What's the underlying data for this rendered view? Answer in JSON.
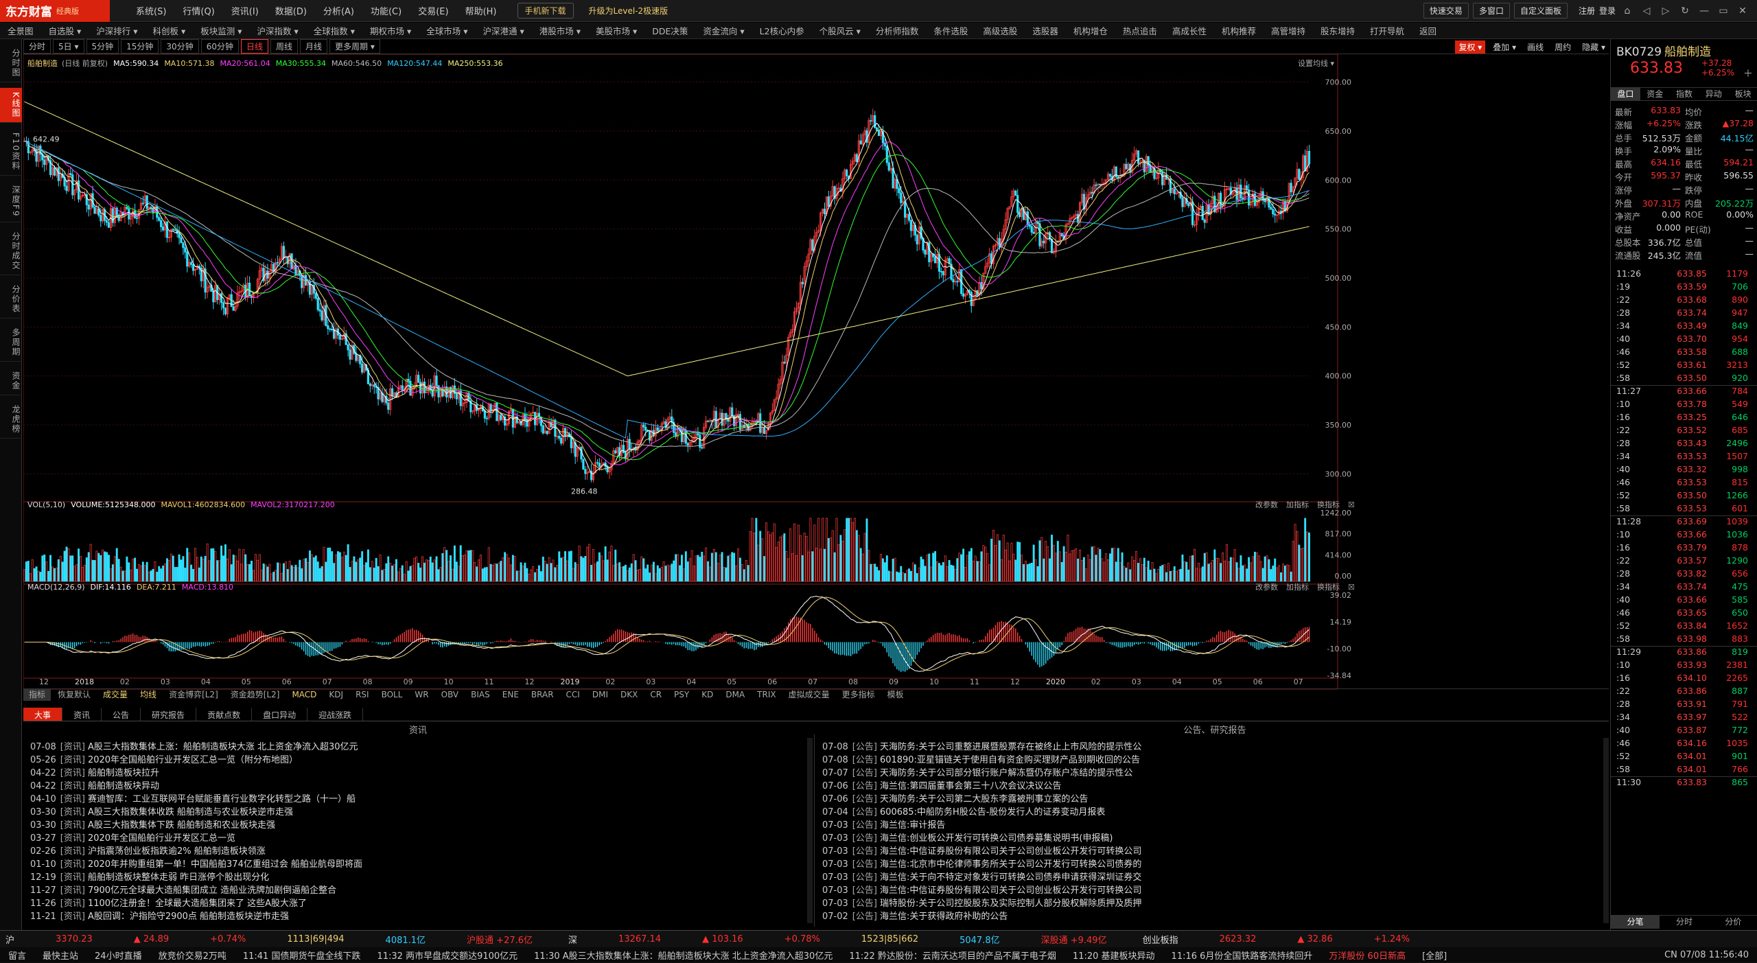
{
  "app": {
    "logo": "东方财富",
    "edition": "经典版",
    "menu": [
      "系统(S)",
      "行情(Q)",
      "资讯(I)",
      "数据(D)",
      "分析(A)",
      "功能(C)",
      "交易(E)",
      "帮助(H)"
    ],
    "mobile_btn": "手机新下载",
    "upgrade": "升级为Level-2极速版",
    "right_btns": [
      "快速交易",
      "多窗口",
      "自定义面板"
    ],
    "login": "注册",
    "login2": "登录"
  },
  "nav": [
    "全景图",
    "自选股 ▾",
    "沪深排行 ▾",
    "科创板 ▾",
    "板块监测 ▾",
    "沪深指数 ▾",
    "全球指数 ▾",
    "期权市场 ▾",
    "全球市场 ▾",
    "沪深港通 ▾",
    "港股市场 ▾",
    "美股市场 ▾",
    "DDE决策",
    "资金流向 ▾",
    "L2核心内参",
    "个股风云 ▾",
    "分析师指数",
    "条件选股",
    "高级选股",
    "选股器",
    "机构增仓",
    "热点追击",
    "高成长性",
    "机构推荐",
    "高管增持",
    "股东增持",
    "打开导航",
    "返回"
  ],
  "sidebar": [
    "分时图",
    "K线图",
    "F10资料",
    "深度F9",
    "分时成交",
    "分价表",
    "多周期",
    "资金",
    "龙虎榜"
  ],
  "kbar": [
    "分时",
    "5日 ▾",
    "5分钟",
    "15分钟",
    "30分钟",
    "60分钟",
    "日线",
    "周线",
    "月线",
    "更多周期 ▾"
  ],
  "kbar_active": "日线",
  "kright": [
    "复权 ▾",
    "叠加 ▾",
    "画线",
    "周约",
    "隐藏 ▾"
  ],
  "chart_title": "船舶制造",
  "chart_sub": "(日线 前复权)",
  "ma_legend": [
    {
      "t": "MA5:590.34",
      "c": "#ffffff"
    },
    {
      "t": "MA10:571.38",
      "c": "#f0d070"
    },
    {
      "t": "MA20:561.04",
      "c": "#ff40ff"
    },
    {
      "t": "MA30:555.34",
      "c": "#30ff30"
    },
    {
      "t": "MA60:546.50",
      "c": "#bbbbbb"
    },
    {
      "t": "MA120:547.44",
      "c": "#30d0ff"
    },
    {
      "t": "MA250:553.36",
      "c": "#f0f080"
    }
  ],
  "setup_label": "设置均线 ▾",
  "vol_legend": {
    "name": "VOL(5,10)",
    "vol": "VOLUME:5125348.000",
    "mavol1": "MAVOL1:4602834.600",
    "mavol2": "MAVOL2:3170217.200"
  },
  "macd_legend": {
    "name": "MACD(12,26,9)",
    "dif": "DIF:14.116",
    "dea": "DEA:7.211",
    "macd": "MACD:13.810"
  },
  "sub_tools": [
    "改参数",
    "加指标",
    "换指标"
  ],
  "price_axis": [
    "700.00",
    "650.00",
    "600.00",
    "550.00",
    "500.00",
    "450.00",
    "400.00",
    "350.00",
    "300.00"
  ],
  "vol_axis": [
    "1242.00",
    "817.00",
    "414.00",
    "0.00"
  ],
  "macd_axis": [
    "39.02",
    "14.19",
    "-10.00",
    "-34.84"
  ],
  "x_axis": [
    "12",
    "2018",
    "02",
    "03",
    "04",
    "05",
    "06",
    "07",
    "08",
    "09",
    "10",
    "11",
    "12",
    "2019",
    "02",
    "03",
    "04",
    "05",
    "06",
    "07",
    "08",
    "09",
    "10",
    "11",
    "12",
    "2020",
    "02",
    "03",
    "04",
    "05",
    "06",
    "07"
  ],
  "hi_label": "642.49",
  "lo_label": "286.48",
  "indicator_tabs": [
    "指标",
    "恢复默认",
    "成交量",
    "均线",
    "资金博弈[L2]",
    "资金趋势[L2]",
    "MACD",
    "KDJ",
    "RSI",
    "BOLL",
    "WR",
    "OBV",
    "BIAS",
    "ENE",
    "BRAR",
    "CCI",
    "DMI",
    "DKX",
    "CR",
    "PSY",
    "KD",
    "DMA",
    "TRIX",
    "虚拟成交量",
    "更多指标",
    "模板"
  ],
  "chart_data": [
    {
      "type": "line",
      "title": "船舶制造",
      "xlabel": "",
      "ylabel": "",
      "x": [
        "2017-12",
        "2018-03",
        "2018-06",
        "2018-09",
        "2018-10",
        "2019-01",
        "2019-03",
        "2019-04",
        "2019-06",
        "2019-09",
        "2019-12",
        "2020-03",
        "2020-05",
        "2020-07"
      ],
      "series": [
        {
          "name": "MA5",
          "values": [
            630,
            570,
            490,
            390,
            300,
            350,
            470,
            600,
            470,
            610,
            600,
            510,
            560,
            630
          ]
        }
      ],
      "ylim": [
        280,
        720
      ]
    },
    {
      "type": "bar",
      "title": "",
      "xlabel": "",
      "ylabel": "",
      "categories": [
        "vol"
      ],
      "values": [
        5125348
      ],
      "ylim": [
        0,
        1242
      ]
    },
    {
      "type": "bar",
      "title": "",
      "xlabel": "",
      "ylabel": "",
      "categories": [
        "MACD"
      ],
      "values": [
        13.81
      ],
      "ylim": [
        -34.84,
        39.02
      ]
    }
  ],
  "stock": {
    "code": "BK0729",
    "name": "船舶制造",
    "price": "633.83",
    "chg": "+37.28",
    "pct": "+6.25%"
  },
  "rtabs": [
    "盘口",
    "资金",
    "指数",
    "异动",
    "板块"
  ],
  "quote": [
    {
      "a": "最新",
      "av": "633.83",
      "ac": "red",
      "b": "均价",
      "bv": "—",
      "bc": "wh"
    },
    {
      "a": "涨幅",
      "av": "+6.25%",
      "ac": "red",
      "b": "涨跌",
      "bv": "▲37.28",
      "bc": "red"
    },
    {
      "a": "总手",
      "av": "512.53万",
      "ac": "wh",
      "b": "金额",
      "bv": "44.15亿",
      "bc": "cy"
    },
    {
      "a": "换手",
      "av": "2.09%",
      "ac": "wh",
      "b": "量比",
      "bv": "—",
      "bc": "wh"
    },
    {
      "a": "最高",
      "av": "634.16",
      "ac": "red",
      "b": "最低",
      "bv": "594.21",
      "bc": "red"
    },
    {
      "a": "今开",
      "av": "595.37",
      "ac": "red",
      "b": "昨收",
      "bv": "596.55",
      "bc": "wh"
    },
    {
      "a": "涨停",
      "av": "—",
      "ac": "wh",
      "b": "跌停",
      "bv": "—",
      "bc": "wh"
    },
    {
      "a": "外盘",
      "av": "307.31万",
      "ac": "red",
      "b": "内盘",
      "bv": "205.22万",
      "bc": "green"
    },
    {
      "a": "净资产",
      "av": "0.00",
      "ac": "wh",
      "b": "ROE",
      "bv": "0.00%",
      "bc": "wh"
    },
    {
      "a": "收益",
      "av": "0.000",
      "ac": "wh",
      "b": "PE(动)",
      "bv": "—",
      "bc": "wh"
    },
    {
      "a": "总股本",
      "av": "336.7亿",
      "ac": "wh",
      "b": "总值",
      "bv": "—",
      "bc": "wh"
    },
    {
      "a": "流通股",
      "av": "245.3亿",
      "ac": "wh",
      "b": "流值",
      "bv": "—",
      "bc": "wh"
    }
  ],
  "ticks": [
    {
      "t": "11:26",
      "p": "633.85",
      "v": "1179",
      "c": "red"
    },
    {
      "t": ":19",
      "p": "633.59",
      "v": "706",
      "c": "green"
    },
    {
      "t": ":22",
      "p": "633.68",
      "v": "890",
      "c": "red"
    },
    {
      "t": ":28",
      "p": "633.74",
      "v": "947",
      "c": "red"
    },
    {
      "t": ":34",
      "p": "633.49",
      "v": "849",
      "c": "green"
    },
    {
      "t": ":40",
      "p": "633.70",
      "v": "954",
      "c": "red"
    },
    {
      "t": ":46",
      "p": "633.58",
      "v": "688",
      "c": "green"
    },
    {
      "t": ":52",
      "p": "633.61",
      "v": "3213",
      "c": "red"
    },
    {
      "t": ":58",
      "p": "633.50",
      "v": "920",
      "c": "green"
    },
    {
      "t": "11:27",
      "p": "633.66",
      "v": "784",
      "c": "red"
    },
    {
      "t": ":10",
      "p": "633.78",
      "v": "549",
      "c": "red"
    },
    {
      "t": ":16",
      "p": "633.25",
      "v": "646",
      "c": "green"
    },
    {
      "t": ":22",
      "p": "633.52",
      "v": "685",
      "c": "red"
    },
    {
      "t": ":28",
      "p": "633.43",
      "v": "2496",
      "c": "green"
    },
    {
      "t": ":34",
      "p": "633.53",
      "v": "1507",
      "c": "red"
    },
    {
      "t": ":40",
      "p": "633.32",
      "v": "998",
      "c": "green"
    },
    {
      "t": ":46",
      "p": "633.53",
      "v": "815",
      "c": "red"
    },
    {
      "t": ":52",
      "p": "633.50",
      "v": "1266",
      "c": "green"
    },
    {
      "t": ":58",
      "p": "633.53",
      "v": "601",
      "c": "red"
    },
    {
      "t": "11:28",
      "p": "633.69",
      "v": "1039",
      "c": "red"
    },
    {
      "t": ":10",
      "p": "633.66",
      "v": "1036",
      "c": "green"
    },
    {
      "t": ":16",
      "p": "633.79",
      "v": "878",
      "c": "red"
    },
    {
      "t": ":22",
      "p": "633.57",
      "v": "1290",
      "c": "green"
    },
    {
      "t": ":28",
      "p": "633.82",
      "v": "656",
      "c": "red"
    },
    {
      "t": ":34",
      "p": "633.74",
      "v": "475",
      "c": "green"
    },
    {
      "t": ":40",
      "p": "633.66",
      "v": "585",
      "c": "green"
    },
    {
      "t": ":46",
      "p": "633.65",
      "v": "650",
      "c": "green"
    },
    {
      "t": ":52",
      "p": "633.84",
      "v": "1652",
      "c": "red"
    },
    {
      "t": ":58",
      "p": "633.98",
      "v": "883",
      "c": "red"
    },
    {
      "t": "11:29",
      "p": "633.86",
      "v": "819",
      "c": "green"
    },
    {
      "t": ":10",
      "p": "633.93",
      "v": "2381",
      "c": "red"
    },
    {
      "t": ":16",
      "p": "634.10",
      "v": "2265",
      "c": "red"
    },
    {
      "t": ":22",
      "p": "633.86",
      "v": "887",
      "c": "green"
    },
    {
      "t": ":28",
      "p": "633.91",
      "v": "791",
      "c": "red"
    },
    {
      "t": ":34",
      "p": "633.97",
      "v": "522",
      "c": "red"
    },
    {
      "t": ":40",
      "p": "633.87",
      "v": "772",
      "c": "green"
    },
    {
      "t": ":46",
      "p": "634.16",
      "v": "1035",
      "c": "red"
    },
    {
      "t": ":52",
      "p": "634.01",
      "v": "901",
      "c": "green"
    },
    {
      "t": ":58",
      "p": "634.01",
      "v": "766",
      "c": "red"
    },
    {
      "t": "11:30",
      "p": "633.83",
      "v": "865",
      "c": "green"
    }
  ],
  "rbottom_tabs": [
    "分笔",
    "分时",
    "分价"
  ],
  "bottom_tabs": [
    "大事",
    "资讯",
    "公告",
    "研究报告",
    "贡献点数",
    "盘口异动",
    "迎战涨跌"
  ],
  "news_head": "资讯",
  "ann_head": "公告、研究报告",
  "news": [
    [
      "07-08",
      "[资讯]",
      "A股三大指数集体上涨：船舶制造板块大涨 北上资金净流入超30亿元"
    ],
    [
      "05-26",
      "[资讯]",
      "2020年全国船舶行业开发区汇总一览（附分布地图）"
    ],
    [
      "04-22",
      "[资讯]",
      "船舶制造板块拉升"
    ],
    [
      "04-22",
      "[资讯]",
      "船舶制造板块异动"
    ],
    [
      "04-10",
      "[资讯]",
      "赛迪智库：工业互联网平台赋能垂直行业数字化转型之路（十一）船"
    ],
    [
      "03-30",
      "[资讯]",
      "A股三大指数集体收跌 船舶制造与农业板块逆市走强"
    ],
    [
      "03-30",
      "[资讯]",
      "A股三大指数集体下跌 船舶制造和农业板块走强"
    ],
    [
      "03-27",
      "[资讯]",
      "2020年全国船舶行业开发区汇总一览"
    ],
    [
      "02-26",
      "[资讯]",
      "沪指震荡创业板指跌逾2% 船舶制造板块领涨"
    ],
    [
      "01-10",
      "[资讯]",
      "2020年并购重组第一单！中国船舶374亿重组过会 船舶业航母即将面"
    ],
    [
      "12-19",
      "[资讯]",
      "船舶制造板块整体走弱 昨日涨停个股出现分化"
    ],
    [
      "11-27",
      "[资讯]",
      "7900亿元全球最大造船集团成立 造船业洗牌加剧倒逼船企整合"
    ],
    [
      "11-26",
      "[资讯]",
      "1100亿注册金！全球最大造船集团来了 这些A股大涨了"
    ],
    [
      "11-21",
      "[资讯]",
      "A股回调：沪指险守2900点 船舶制造板块逆市走强"
    ]
  ],
  "anns": [
    [
      "07-08",
      "[公告]",
      "天海防务:关于公司重整进展暨股票存在被终止上市风险的提示性公"
    ],
    [
      "07-08",
      "[公告]",
      "601890:亚星锚链关于使用自有资金购买理财产品到期收回的公告"
    ],
    [
      "07-07",
      "[公告]",
      "天海防务:关于公司部分银行账户解冻暨仍存账户冻结的提示性公"
    ],
    [
      "07-06",
      "[公告]",
      "海兰信:第四届董事会第三十八次会议决议公告"
    ],
    [
      "07-06",
      "[公告]",
      "天海防务:关于公司第二大股东李露被刑事立案的公告"
    ],
    [
      "07-04",
      "[公告]",
      "600685:中船防务H股公告-股份发行人的证券变动月报表"
    ],
    [
      "07-03",
      "[公告]",
      "海兰信:审计报告"
    ],
    [
      "07-03",
      "[公告]",
      "海兰信:创业板公开发行可转换公司债券募集说明书(申报稿)"
    ],
    [
      "07-03",
      "[公告]",
      "海兰信:中信证券股份有限公司关于公司创业板公开发行可转换公司"
    ],
    [
      "07-03",
      "[公告]",
      "海兰信:北京市中伦律师事务所关于公司公开发行可转换公司债券的"
    ],
    [
      "07-03",
      "[公告]",
      "海兰信:关于向不特定对象发行可转换公司债券申请获得深圳证券交"
    ],
    [
      "07-03",
      "[公告]",
      "海兰信:中信证券股份有限公司关于公司创业板公开发行可转换公司"
    ],
    [
      "07-03",
      "[公告]",
      "瑞特股份:关于公司控股股东及实际控制人部分股权解除质押及质押"
    ],
    [
      "07-02",
      "[公告]",
      "海兰信:关于获得政府补助的公告"
    ]
  ],
  "status1": [
    {
      "t": "沪",
      "c": "wh"
    },
    {
      "t": "3370.23",
      "c": "red"
    },
    {
      "t": "▲ 24.89",
      "c": "red"
    },
    {
      "t": "+0.74%",
      "c": "red"
    },
    {
      "t": "1113|69|494",
      "c": "yel"
    },
    {
      "t": "4081.1亿",
      "c": "cy"
    },
    {
      "t": "沪股通 +27.6亿",
      "c": "red"
    },
    {
      "t": "深",
      "c": "wh"
    },
    {
      "t": "13267.14",
      "c": "red"
    },
    {
      "t": "▲ 103.16",
      "c": "red"
    },
    {
      "t": "+0.78%",
      "c": "red"
    },
    {
      "t": "1523|85|662",
      "c": "yel"
    },
    {
      "t": "5047.8亿",
      "c": "cy"
    },
    {
      "t": "深股通 +9.49亿",
      "c": "red"
    },
    {
      "t": "创业板指",
      "c": "wh"
    },
    {
      "t": "2623.32",
      "c": "red"
    },
    {
      "t": "▲ 32.86",
      "c": "red"
    },
    {
      "t": "+1.24%",
      "c": "red"
    }
  ],
  "status2": [
    "留言",
    "最快主站",
    "24小时直播",
    "放竞价交易2万吨",
    "11:41 国债期货午盘全线下跌",
    "11:32 两市早盘成交额达9100亿元",
    "11:30 A股三大指数集体上涨：船舶制造板块大涨 北上资金净流入超30亿元",
    "11:22 黔达股份：云南沃达项目的产品不属于电子烟",
    "11:20 基建板块异动",
    "11:16 6月份全国铁路客流持续回升",
    "万洋股份 60日新高",
    "[全部]",
    "CN 07/08 11:56:40"
  ]
}
